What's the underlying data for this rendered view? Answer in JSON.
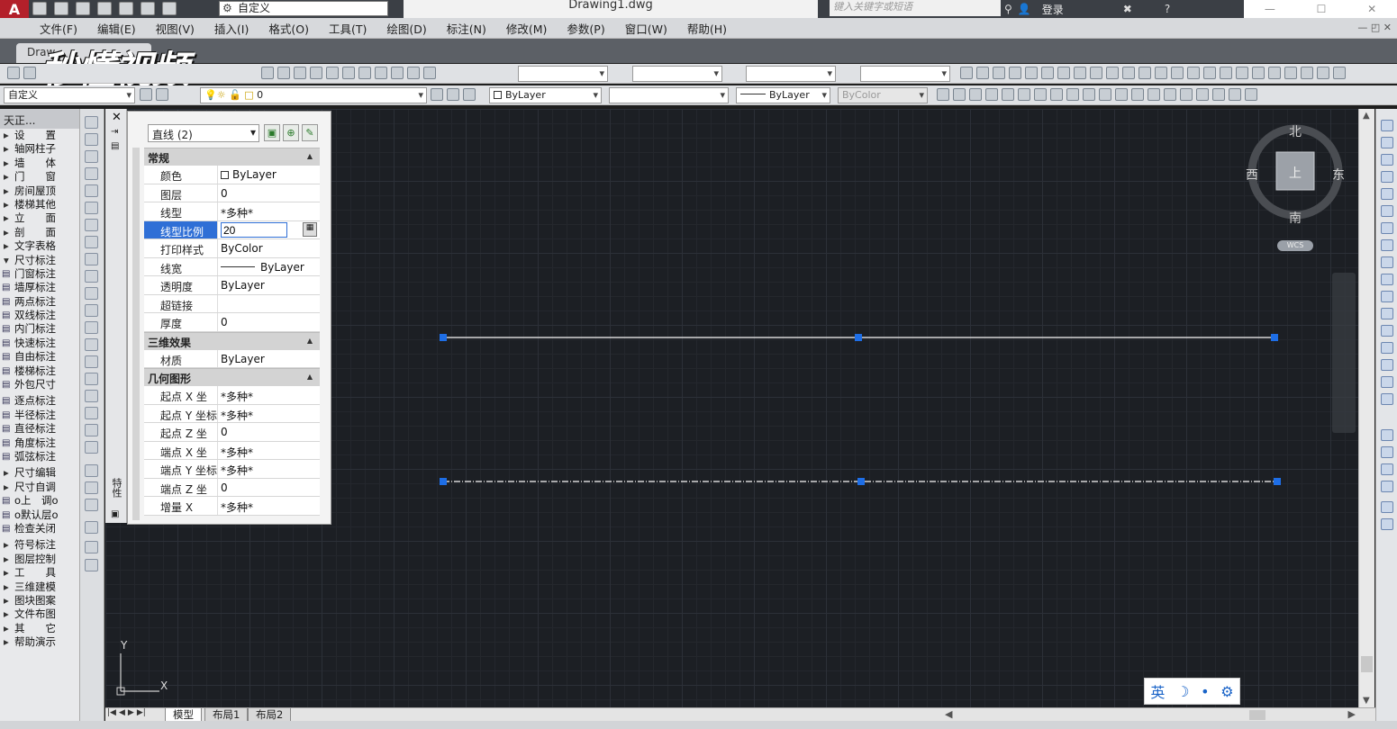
{
  "app": {
    "logo": "A",
    "workspace": "自定义",
    "document_title": "Drawing1.dwg",
    "search_placeholder": "键入关键字或短语",
    "login_label": "登录",
    "watermark": "秒懂视频"
  },
  "menubar": [
    "文件(F)",
    "编辑(E)",
    "视图(V)",
    "插入(I)",
    "格式(O)",
    "工具(T)",
    "绘图(D)",
    "标注(N)",
    "修改(M)",
    "参数(P)",
    "窗口(W)",
    "帮助(H)"
  ],
  "doc_tab": "Draw",
  "toolbar2": {
    "workspace_combo": "自定义",
    "layer_combo": "0",
    "color_combo": "ByLayer",
    "linetype_combo": "",
    "lineweight_combo": "ByLayer",
    "plotstyle_combo": "ByColor"
  },
  "left_menu": {
    "title": "天正...",
    "groups_top": [
      "设　　置",
      "轴网柱子",
      "墙　　体",
      "门　　窗",
      "房间屋顶",
      "楼梯其他",
      "立　　面",
      "剖　　面",
      "文字表格"
    ],
    "open_group": "尺寸标注",
    "dim_tools_a": [
      "门窗标注",
      "墙厚标注",
      "两点标注",
      "双线标注",
      "内门标注",
      "快速标注",
      "自由标注",
      "楼梯标注",
      "外包尺寸"
    ],
    "dim_tools_b": [
      "逐点标注",
      "半径标注",
      "直径标注",
      "角度标注",
      "弧弦标注"
    ],
    "dim_tools_c": [
      "尺寸编辑",
      "尺寸自调",
      "o上　调o",
      "o默认层o",
      "检查关闭"
    ],
    "groups_bottom": [
      "符号标注",
      "图层控制",
      "工　　具",
      "三维建模",
      "图块图案",
      "文件布图",
      "其　　它",
      "帮助演示"
    ]
  },
  "properties": {
    "palette_label": "特性",
    "object_select": "直线 (2)",
    "sections": [
      {
        "title": "常规",
        "rows": [
          {
            "key": "颜色",
            "value": "ByLayer",
            "swatch": true
          },
          {
            "key": "图层",
            "value": "0"
          },
          {
            "key": "线型",
            "value": "*多种*"
          },
          {
            "key": "线型比例",
            "value": "20",
            "selected": true
          },
          {
            "key": "打印样式",
            "value": "ByColor"
          },
          {
            "key": "线宽",
            "value": "ByLayer",
            "lineweight": true
          },
          {
            "key": "透明度",
            "value": "ByLayer"
          },
          {
            "key": "超链接",
            "value": ""
          },
          {
            "key": "厚度",
            "value": "0"
          }
        ]
      },
      {
        "title": "三维效果",
        "rows": [
          {
            "key": "材质",
            "value": "ByLayer"
          }
        ]
      },
      {
        "title": "几何图形",
        "rows": [
          {
            "key": "起点 X 坐标",
            "value": "*多种*"
          },
          {
            "key": "起点 Y 坐标",
            "value": "*多种*"
          },
          {
            "key": "起点 Z 坐标",
            "value": "0"
          },
          {
            "key": "端点 X 坐标",
            "value": "*多种*"
          },
          {
            "key": "端点 Y 坐标",
            "value": "*多种*"
          },
          {
            "key": "端点 Z 坐标",
            "value": "0"
          },
          {
            "key": "增量 X",
            "value": "*多种*"
          }
        ]
      }
    ]
  },
  "viewcube": {
    "north": "北",
    "south": "南",
    "east": "东",
    "west": "西",
    "face": "上",
    "wcs": "WCS"
  },
  "ucs": {
    "x": "X",
    "y": "Y"
  },
  "ime": {
    "lang": "英",
    "moon": "☽",
    "dot": "•",
    "gear": "⚙"
  },
  "layout_tabs": [
    "模型",
    "布局1",
    "布局2"
  ],
  "colors": {
    "selection_blue": "#2f6fd6",
    "grip_blue": "#1e6ee6",
    "canvas_bg": "#1c1f24"
  }
}
